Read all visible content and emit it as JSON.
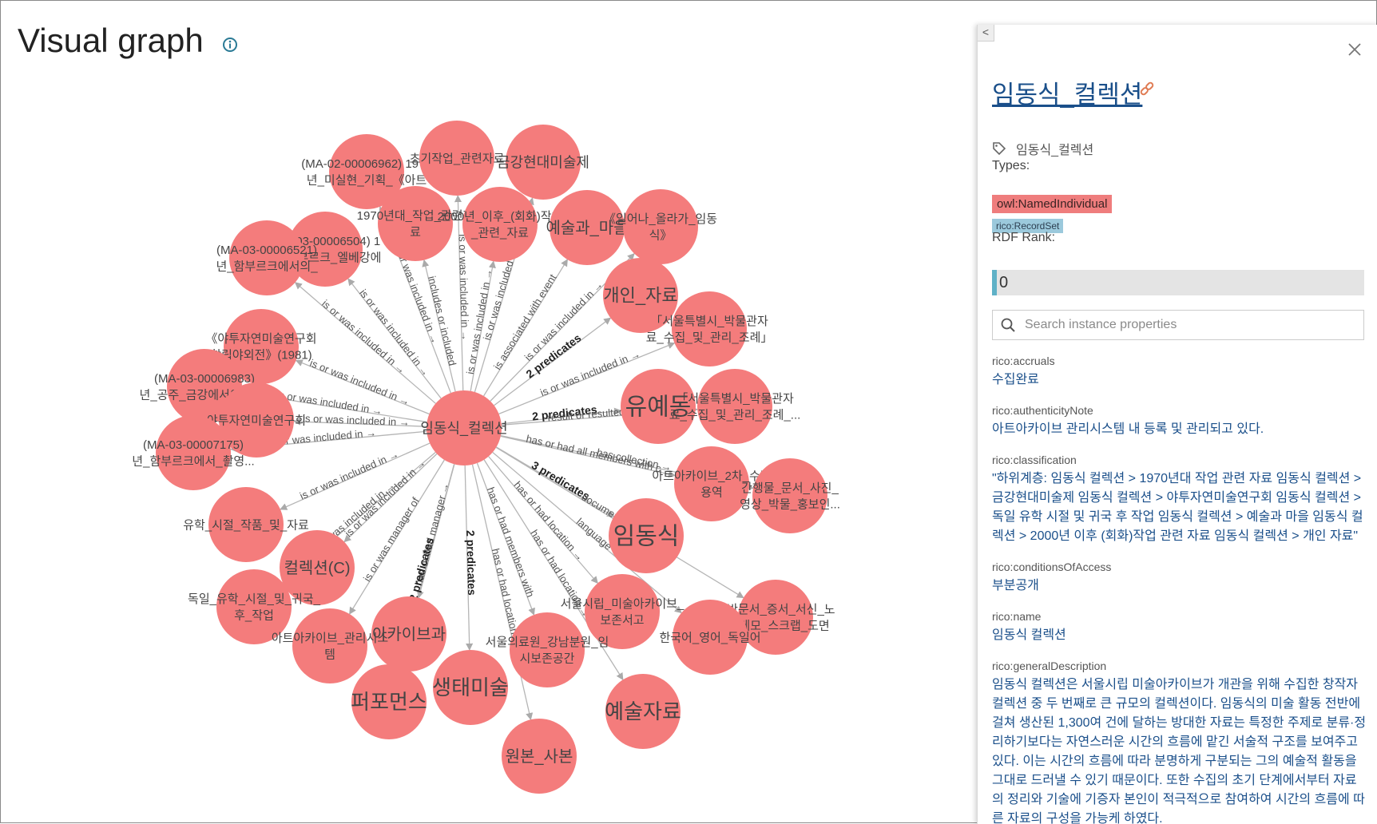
{
  "page": {
    "title": "Visual graph"
  },
  "graph": {
    "center": {
      "label": "임동식_컬렉션"
    },
    "nodes": [
      {
        "label": "(MA-02-00006962) 1970\n년_미실현_기획_《아트"
      },
      {
        "label": "초기작업_관련자료"
      },
      {
        "label": "금강현대미술제"
      },
      {
        "label": "1970년대_작업_관련자\n료"
      },
      {
        "label": "2000년_이후_(회화)작업\n_관련_자료"
      },
      {
        "label": "예술과_마을"
      },
      {
        "label": "《일어나_올라가_임동\n식》"
      },
      {
        "label": "(MA-03-00006504) 1\n년_함부르크_엘베강에"
      },
      {
        "label": "(MA-03-00006521)\n년_함부르크에서의_"
      },
      {
        "label": "개인_자료"
      },
      {
        "label": "「서울특별시_박물관자\n료_수집_및_관리_조례」"
      },
      {
        "label": "《야투자연미술연구회\n창립야외전》(1981)"
      },
      {
        "label": "(MA-03-00006983)\n년_공주_금강에서의_〈..."
      },
      {
        "label": "유예동"
      },
      {
        "label": "「서울특별시_박물관자\n료_수집_및_관리_조례_..."
      },
      {
        "label": "야투자연미술연구회"
      },
      {
        "label": "(MA-03-00007175)\n년_함부르크에서_촬영..."
      },
      {
        "label": "아트아카이브_2차_수집\n용역"
      },
      {
        "label": "간행물_문서_사진_\n영상_박물_홍보인..."
      },
      {
        "label": "유학_시절_작품_및_자료"
      },
      {
        "label": "임동식"
      },
      {
        "label": "컬렉션(C)"
      },
      {
        "label": "독일_유학_시절_및_귀국_\n후_작업"
      },
      {
        "label": "서울시립_미술아카이브_\n보존서고"
      },
      {
        "label": "일반문서_증서_서신_노\n트_메모_스크랩_도면"
      },
      {
        "label": "아카이브과"
      },
      {
        "label": "한국어_영어_독일어"
      },
      {
        "label": "아트아카이브_관리시스\n템"
      },
      {
        "label": "서울의료원_강남분원_임\n시보존공간"
      },
      {
        "label": "생태미술"
      },
      {
        "label": "퍼포먼스"
      },
      {
        "label": "예술자료"
      },
      {
        "label": "원본_사본"
      }
    ],
    "edge_labels": [
      "is or was included in →",
      "2 predicates",
      "has collection →",
      "has or had all members with c",
      "result or resulted from →",
      "3 predicates",
      "has or had location →",
      "documentary form type",
      "has or had manager →",
      "is or was manager of",
      "is associated with event",
      "includes or included",
      "language",
      "has or had members with"
    ]
  },
  "panel": {
    "collapse_label": "<",
    "title": "임동식_컬렉션",
    "tag": "임동식_컬렉션",
    "types_label": "Types:",
    "types": [
      "owl:NamedIndividual",
      "rico:RecordSet"
    ],
    "rank_label": "RDF Rank:",
    "rank_value": "0",
    "search_placeholder": "Search instance properties",
    "properties": [
      {
        "name": "rico:accruals",
        "value": "수집완료"
      },
      {
        "name": "rico:authenticityNote",
        "value": "아트아카이브 관리시스템 내 등록 및 관리되고 있다."
      },
      {
        "name": "rico:classification",
        "value": "\"하위계층: 임동식 컬렉션 > 1970년대 작업 관련 자료 임동식 컬렉션 > 금강현대미술제 임동식 컬렉션 > 야투자연미술연구회 임동식 컬렉션 > 독일 유학 시절 및 귀국 후 작업 임동식 컬렉션 > 예술과 마을 임동식 컬렉션 > 2000년 이후 (회화)작업 관련 자료 임동식 컬렉션 > 개인 자료\""
      },
      {
        "name": "rico:conditionsOfAccess",
        "value": "부분공개"
      },
      {
        "name": "rico:name",
        "value": "임동식 컬렉션"
      },
      {
        "name": "rico:generalDescription",
        "value": "임동식 컬렉션은 서울시립 미술아카이브가 개관을 위해 수집한 창작자 컬렉션 중 두 번째로 큰 규모의 컬렉션이다. 임동식의 미술 활동 전반에 걸쳐 생산된 1,300여 건에 달하는 방대한 자료는 특정한 주제로 분류·정리하기보다는 자연스러운 시간의 흐름에 맡긴 서술적 구조를 보여주고 있다. 이는 시간의 흐름에 따라 분명하게 구분되는 그의 예술적 활동을 그대로 드러낼 수 있기 때문이다. 또한 수집의 초기 단계에서부터 자료의 정리와 기술에 기증자 본인이 적극적으로 참여하여 시간의 흐름에 따른 자료의 구성을 가능케 하였다."
      }
    ]
  },
  "colors": {
    "node": "#f47c7c",
    "edge": "#b5b5b5",
    "link": "#1a4f8a",
    "type_owl": "#ef7d7d",
    "type_rico": "#9bc9dc"
  }
}
